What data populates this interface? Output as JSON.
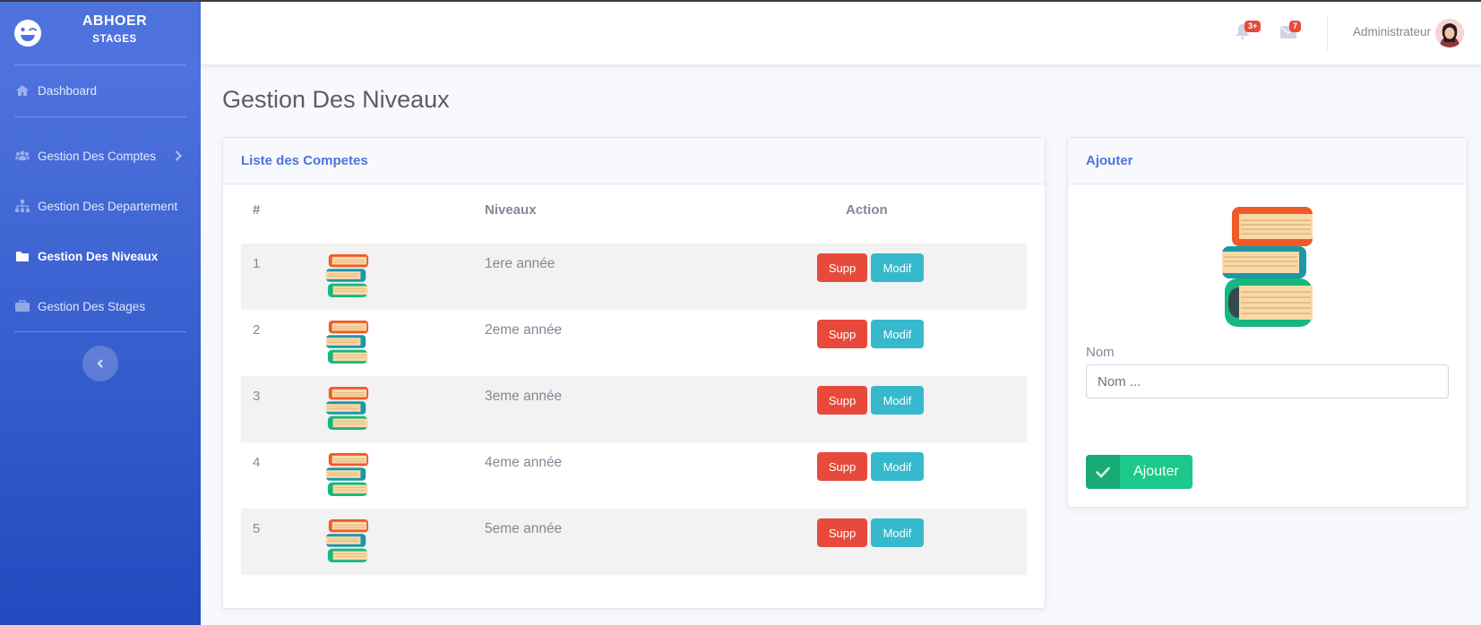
{
  "brand": {
    "title": "ABHOER",
    "subtitle": "STAGES"
  },
  "sidebar": {
    "items": [
      {
        "label": "Dashboard",
        "icon": "home-icon"
      },
      {
        "label": "Gestion Des Comptes",
        "icon": "users-icon",
        "has_submenu": true
      },
      {
        "label": "Gestion Des Departement",
        "icon": "sitemap-icon"
      },
      {
        "label": "Gestion Des Niveaux",
        "icon": "folder-icon",
        "active": true
      },
      {
        "label": "Gestion Des Stages",
        "icon": "briefcase-icon"
      }
    ],
    "toggle_icon": "chevron-left-icon"
  },
  "topbar": {
    "alerts_badge": "3+",
    "messages_badge": "7",
    "user_name": "Administrateur"
  },
  "page": {
    "title": "Gestion Des Niveaux"
  },
  "list_card": {
    "header": "Liste des Competes",
    "columns": [
      "#",
      "Niveaux",
      "Action"
    ],
    "rows": [
      {
        "num": "1",
        "name": "1ere année"
      },
      {
        "num": "2",
        "name": "2eme année"
      },
      {
        "num": "3",
        "name": "3eme année"
      },
      {
        "num": "4",
        "name": "4eme année"
      },
      {
        "num": "5",
        "name": "5eme année"
      }
    ],
    "delete_label": "Supp",
    "edit_label": "Modif"
  },
  "add_card": {
    "header": "Ajouter",
    "name_label": "Nom",
    "name_placeholder": "Nom ...",
    "name_value": "",
    "submit_label": "Ajouter"
  },
  "colors": {
    "primary": "#4e73df",
    "danger": "#e74a3b",
    "info": "#36b9cc",
    "success": "#1cc88a"
  }
}
